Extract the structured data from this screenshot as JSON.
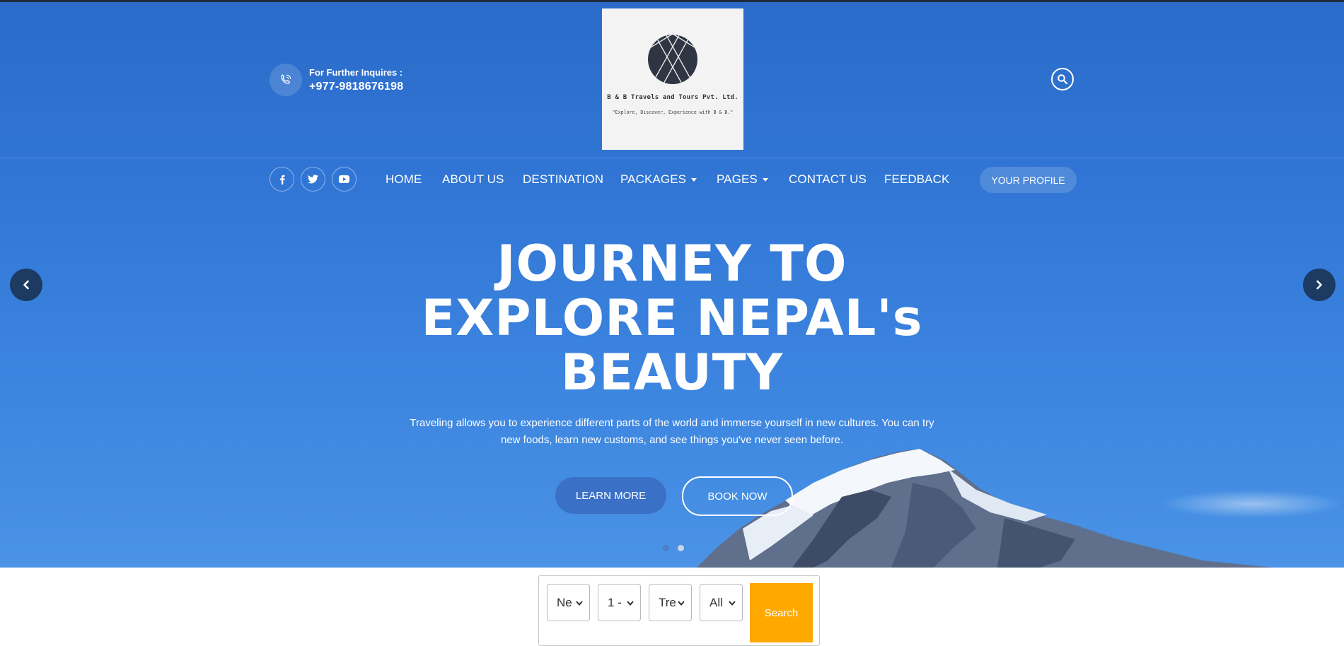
{
  "header": {
    "contact_label": "For Further Inquires :",
    "contact_phone": "+977-9818676198",
    "logo_name": "B & B Travels and Tours Pvt. Ltd.",
    "logo_tagline": "\"Explore, Discover, Experience with B & B.\""
  },
  "nav": {
    "items": [
      {
        "label": "HOME"
      },
      {
        "label": "ABOUT US"
      },
      {
        "label": "DESTINATION"
      },
      {
        "label": "PACKAGES",
        "dropdown": true
      },
      {
        "label": "PAGES",
        "dropdown": true
      },
      {
        "label": "CONTACT US"
      },
      {
        "label": "FEEDBACK"
      }
    ],
    "profile_button": "YOUR PROFILE"
  },
  "socials": [
    "facebook-icon",
    "twitter-icon",
    "youtube-icon"
  ],
  "hero": {
    "headline_lines": [
      "JOURNEY TO",
      "EXPLORE NEPAL's",
      "BEAUTY"
    ],
    "subtitle": "Traveling allows you to experience different parts of the world and immerse yourself in new cultures. You can try new foods, learn new customs, and see things you've never seen before.",
    "learn_more": "LEARN MORE",
    "book_now": "BOOK NOW",
    "slide_count": 2,
    "active_slide": 1
  },
  "search_bar": {
    "selects": [
      {
        "value": "Ne"
      },
      {
        "value": "1 -"
      },
      {
        "value": "Tre"
      },
      {
        "value": "All"
      }
    ],
    "button": "Search"
  },
  "colors": {
    "hero_blue": "#3277d6",
    "search_orange": "#ffa800",
    "arrow_navy": "#1d3a63"
  }
}
